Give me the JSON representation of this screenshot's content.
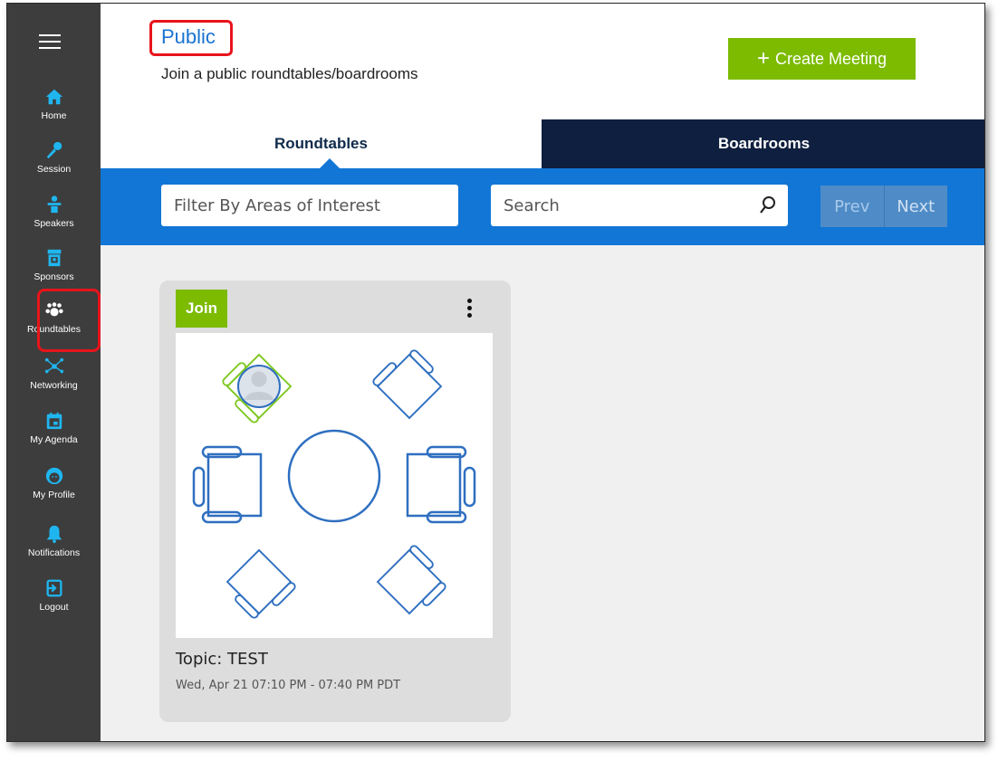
{
  "sidebar": {
    "items": [
      {
        "label": "Home",
        "icon": "home-icon"
      },
      {
        "label": "Session",
        "icon": "microphone-icon"
      },
      {
        "label": "Speakers",
        "icon": "speaker-podium-icon"
      },
      {
        "label": "Sponsors",
        "icon": "sponsor-booth-icon"
      },
      {
        "label": "Roundtables",
        "icon": "group-icon"
      },
      {
        "label": "Networking",
        "icon": "network-icon"
      },
      {
        "label": "My Agenda",
        "icon": "calendar-icon"
      },
      {
        "label": "My Profile",
        "icon": "profile-face-icon"
      },
      {
        "label": "Notifications",
        "icon": "bell-icon"
      },
      {
        "label": "Logout",
        "icon": "logout-icon"
      }
    ],
    "active": "Roundtables",
    "icon_color": "#1fb6f0"
  },
  "header": {
    "title": "Public",
    "subtitle": "Join a public roundtables/boardrooms",
    "create_label": "Create Meeting"
  },
  "tabs": [
    {
      "label": "Roundtables",
      "active": true
    },
    {
      "label": "Boardrooms",
      "active": false
    }
  ],
  "filters": {
    "interest_placeholder": "Filter By Areas of Interest",
    "search_placeholder": "Search",
    "prev_label": "Prev",
    "next_label": "Next"
  },
  "card": {
    "join_label": "Join",
    "topic": "Topic: TEST",
    "time": "Wed, Apr 21 07:10 PM - 07:40 PM PDT",
    "seats_total": 6,
    "seats_occupied": 1
  },
  "colors": {
    "accent_green": "#7cbb00",
    "accent_blue": "#1176d6",
    "title_blue": "#1a73d1",
    "dark_tab": "#0f1f3f",
    "sidebar": "#3d3d3d",
    "highlight_red": "#e8141b"
  }
}
